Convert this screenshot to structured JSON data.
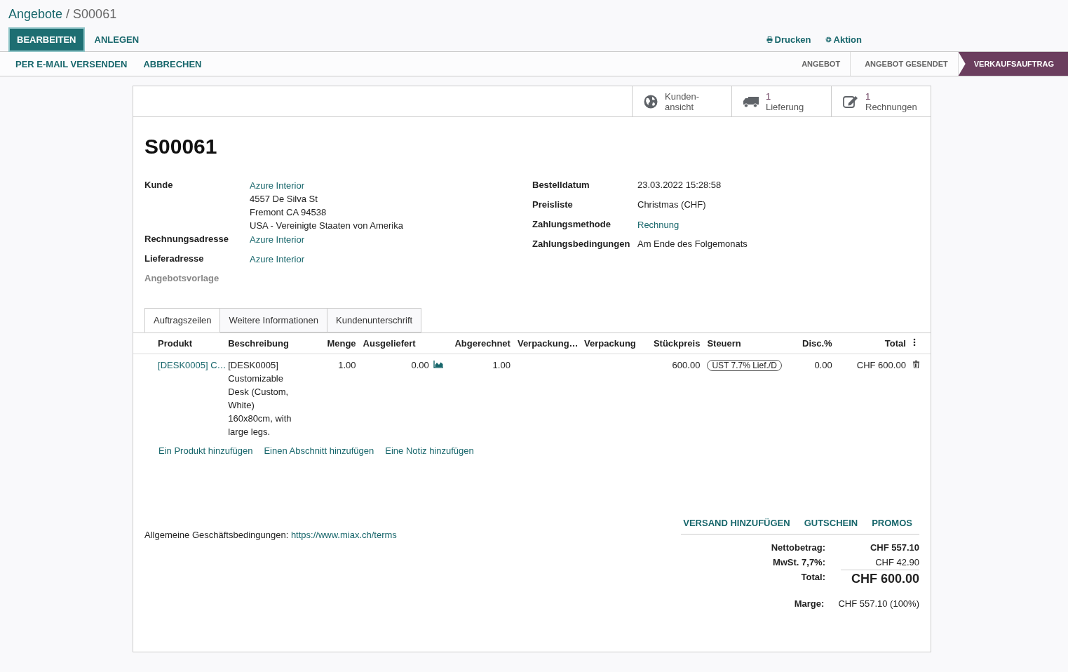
{
  "breadcrumb": {
    "parent": "Angebote",
    "separator": "/",
    "current": "S00061"
  },
  "main_buttons": [
    {
      "label": "BEARBEITEN",
      "kind": "primary"
    },
    {
      "label": "ANLEGEN",
      "kind": "link"
    }
  ],
  "actions": [
    {
      "label": "Drucken",
      "kind": "print"
    },
    {
      "label": "Aktion",
      "kind": "gear"
    }
  ],
  "header_buttons": [
    "PER E-MAIL VERSENDEN",
    "ABBRECHEN"
  ],
  "statusbar": [
    {
      "label": "ANGEBOT",
      "selected": false
    },
    {
      "label": "ANGEBOT GESENDET",
      "selected": false
    },
    {
      "label": "VERKAUFSAUFTRAG",
      "selected": true
    }
  ],
  "smart_buttons": [
    {
      "kind": "globe",
      "lines": [
        "Kunden-",
        "ansicht"
      ]
    },
    {
      "kind": "truck",
      "count": "1",
      "lines": [
        "Lieferung"
      ]
    },
    {
      "kind": "edit",
      "count": "1",
      "lines": [
        "Rechnungen"
      ]
    }
  ],
  "title": "S00061",
  "left_fields": [
    {
      "label": "Kunde",
      "link": "Azure Interior",
      "lines": [
        "4557 De Silva St",
        "Fremont CA 94538",
        "USA - Vereinigte Staaten von Amerika"
      ]
    },
    {
      "label": "Rechnungsadresse",
      "link": "Azure Interior"
    },
    {
      "label": "Lieferadresse",
      "link": "Azure Interior"
    },
    {
      "label": "Angebotsvorlage"
    }
  ],
  "right_fields": [
    {
      "label": "Bestelldatum",
      "lines": [
        "23.03.2022 15:28:58"
      ]
    },
    {
      "label": "Preisliste",
      "lines": [
        "Christmas (CHF)"
      ]
    },
    {
      "label": "Zahlungsmethode",
      "link": "Rechnung"
    },
    {
      "label": "Zahlungsbedingungen",
      "lines": [
        "Am Ende des Folgemonats"
      ]
    }
  ],
  "tabs": [
    {
      "label": "Auftragszeilen",
      "selected": true
    },
    {
      "label": "Weitere Informationen",
      "selected": false
    },
    {
      "label": "Kundenunterschrift",
      "selected": false
    }
  ],
  "table": {
    "columns": [
      {
        "label": "Produkt",
        "kind": "text"
      },
      {
        "label": "Beschreibung",
        "kind": "text"
      },
      {
        "label": "Menge",
        "kind": "number"
      },
      {
        "label": "Ausgeliefert",
        "kind": "text"
      },
      {
        "label": "Abgerechnet",
        "kind": "number"
      },
      {
        "label": "Verpackung…",
        "kind": "text"
      },
      {
        "label": "Verpackung",
        "kind": "text"
      },
      {
        "label": "Stückpreis",
        "kind": "number"
      },
      {
        "label": "Steuern",
        "kind": "text"
      },
      {
        "label": "Disc.%",
        "kind": "number"
      },
      {
        "label": "Total",
        "kind": "number"
      }
    ],
    "rows": [
      {
        "product": "[DESK0005] C…",
        "description": "[DESK0005] Customizable Desk (Custom, White) 160x80cm, with large legs.",
        "quantity": "1.00",
        "delivered": "0.00",
        "invoiced": "1.00",
        "unit_price": "600.00",
        "tax": "UST 7.7% Lief./D",
        "discount": "0.00",
        "total": "CHF 600.00"
      }
    ]
  },
  "add_links": [
    "Ein Produkt hinzufügen",
    "Einen Abschnitt hinzufügen",
    "Eine Notiz hinzufügen"
  ],
  "footer_buttons": [
    "VERSAND HINZUFÜGEN",
    "GUTSCHEIN",
    "PROMOS"
  ],
  "terms": {
    "label": "Allgemeine Geschäftsbedingungen:",
    "link": "https://www.miax.ch/terms"
  },
  "totals": [
    {
      "label": "Nettobetrag:",
      "value": "CHF 557.10",
      "kind": "subtotal"
    },
    {
      "label": "MwSt. 7,7%:",
      "value": "CHF 42.90",
      "kind": "tax"
    },
    {
      "label": "Total:",
      "value": "CHF 600.00",
      "kind": "grand"
    }
  ],
  "margin": {
    "label": "Marge:",
    "value": "CHF 557.10 (100%)"
  }
}
